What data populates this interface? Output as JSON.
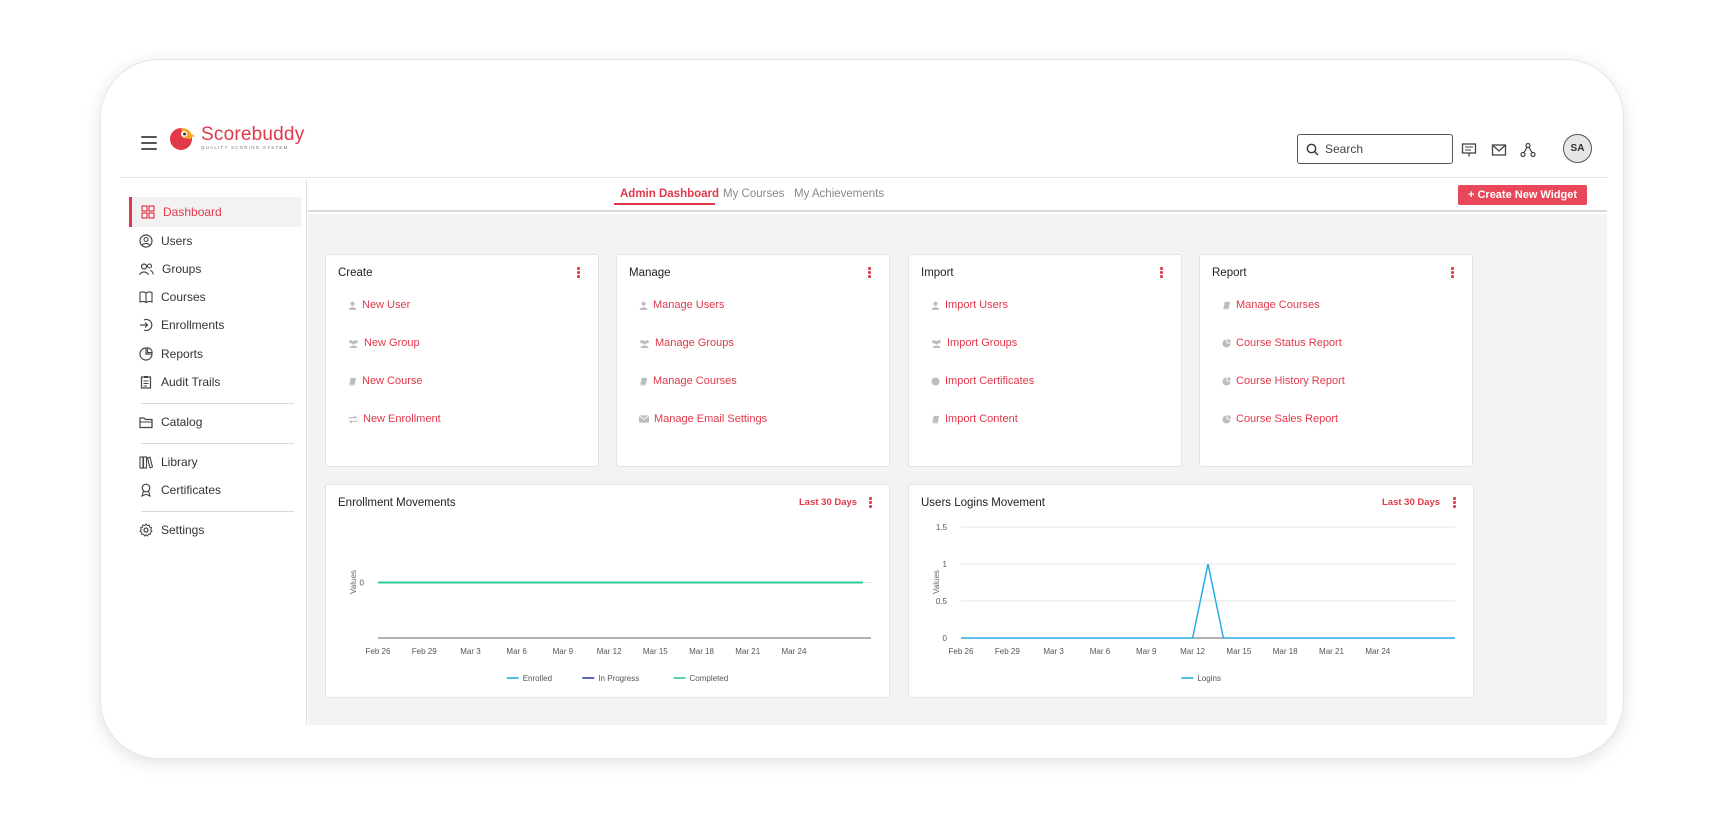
{
  "app": {
    "name": "Scorebuddy",
    "tagline": "QUALITY SCORING SYSTEM"
  },
  "header": {
    "search_placeholder": "Search",
    "avatar_initials": "SA"
  },
  "sidebar": {
    "items": [
      {
        "label": "Dashboard",
        "icon": "grid-icon",
        "active": true
      },
      {
        "label": "Users",
        "icon": "user-circle-icon"
      },
      {
        "label": "Groups",
        "icon": "users-icon"
      },
      {
        "label": "Courses",
        "icon": "book-open-icon"
      },
      {
        "label": "Enrollments",
        "icon": "enroll-icon"
      },
      {
        "label": "Reports",
        "icon": "pie-chart-icon"
      },
      {
        "label": "Audit Trails",
        "icon": "clipboard-icon"
      },
      {
        "label": "Catalog",
        "icon": "folder-icon"
      },
      {
        "label": "Library",
        "icon": "library-icon"
      },
      {
        "label": "Certificates",
        "icon": "award-icon"
      },
      {
        "label": "Settings",
        "icon": "gear-icon"
      }
    ]
  },
  "tabs": [
    {
      "label": "Admin Dashboard",
      "active": true
    },
    {
      "label": "My Courses"
    },
    {
      "label": "My Achievements"
    }
  ],
  "create_widget_label": "+ Create New Widget",
  "widgets": [
    {
      "title": "Create",
      "links": [
        {
          "label": "New User",
          "icon": "user-icon"
        },
        {
          "label": "New Group",
          "icon": "group-icon"
        },
        {
          "label": "New Course",
          "icon": "book-icon"
        },
        {
          "label": "New Enrollment",
          "icon": "exchange-icon"
        }
      ]
    },
    {
      "title": "Manage",
      "links": [
        {
          "label": "Manage Users",
          "icon": "user-icon"
        },
        {
          "label": "Manage Groups",
          "icon": "group-icon"
        },
        {
          "label": "Manage Courses",
          "icon": "book-icon"
        },
        {
          "label": "Manage Email Settings",
          "icon": "envelope-icon"
        }
      ]
    },
    {
      "title": "Import",
      "links": [
        {
          "label": "Import Users",
          "icon": "user-icon"
        },
        {
          "label": "Import Groups",
          "icon": "group-icon"
        },
        {
          "label": "Import Certificates",
          "icon": "certificate-icon"
        },
        {
          "label": "Import Content",
          "icon": "book-icon"
        }
      ]
    },
    {
      "title": "Report",
      "links": [
        {
          "label": "Manage Courses",
          "icon": "book-icon"
        },
        {
          "label": "Course Status Report",
          "icon": "pie-icon"
        },
        {
          "label": "Course History Report",
          "icon": "pie-icon"
        },
        {
          "label": "Course Sales Report",
          "icon": "pie-icon"
        }
      ]
    }
  ],
  "colors": {
    "accent": "#e1384a",
    "enrolled": "#29abe2",
    "in_progress": "#3a3fa8",
    "completed": "#2ecc8f",
    "logins": "#29abe2"
  },
  "chart_data": [
    {
      "type": "line",
      "title": "Enrollment Movements",
      "range_label": "Last 30 Days",
      "ylabel": "Values",
      "x": [
        "Feb 26",
        "Feb 29",
        "Mar 3",
        "Mar 6",
        "Mar 9",
        "Mar 12",
        "Mar 15",
        "Mar 18",
        "Mar 21",
        "Mar 24"
      ],
      "yticks": [
        "0"
      ],
      "ylim": [
        -1,
        1
      ],
      "series": [
        {
          "name": "Enrolled",
          "values": [
            0,
            0,
            0,
            0,
            0,
            0,
            0,
            0,
            0,
            0
          ]
        },
        {
          "name": "In Progress",
          "values": [
            0,
            0,
            0,
            0,
            0,
            0,
            0,
            0,
            0,
            0
          ]
        },
        {
          "name": "Completed",
          "values": [
            0,
            0,
            0,
            0,
            0,
            0,
            0,
            0,
            0,
            0
          ]
        }
      ],
      "legend": "bottom"
    },
    {
      "type": "line",
      "title": "Users Logins Movement",
      "range_label": "Last 30 Days",
      "ylabel": "Values",
      "x": [
        "Feb 26",
        "Feb 29",
        "Mar 3",
        "Mar 6",
        "Mar 9",
        "Mar 12",
        "Mar 15",
        "Mar 18",
        "Mar 21",
        "Mar 24"
      ],
      "yticks": [
        "0",
        "0.5",
        "1",
        "1.5"
      ],
      "ylim": [
        0,
        1.5
      ],
      "series": [
        {
          "name": "Logins",
          "points": [
            [
              "Feb 26",
              0
            ],
            [
              "Mar 12",
              0
            ],
            [
              "Mar 13",
              1
            ],
            [
              "Mar 14",
              0
            ],
            [
              "Mar 29",
              0
            ]
          ]
        }
      ],
      "legend": "bottom"
    }
  ]
}
